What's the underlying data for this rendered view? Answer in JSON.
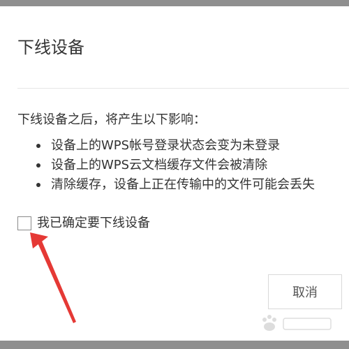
{
  "dialog": {
    "title": "下线设备",
    "intro": "下线设备之后，将产生以下影响：",
    "impacts": [
      "设备上的WPS帐号登录状态会变为未登录",
      "设备上的WPS云文档缓存文件会被清除",
      "清除缓存，设备上正在传输中的文件可能会丢失"
    ],
    "confirm_label": "我已确定要下线设备",
    "confirm_checked": false,
    "cancel_label": "取消"
  },
  "colors": {
    "overlay": "#8f8f8f",
    "annotation_arrow": "#e53935"
  },
  "icons": {
    "annotation": "red-arrow-icon",
    "watermark": "baidu-watermark-icon"
  }
}
